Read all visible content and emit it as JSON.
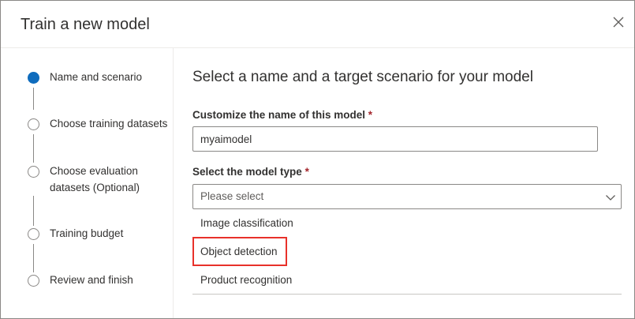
{
  "dialog": {
    "title": "Train a new model",
    "close_icon": "close-icon"
  },
  "stepper": {
    "steps": [
      {
        "label": "Name and scenario",
        "active": true
      },
      {
        "label": "Choose training datasets",
        "active": false
      },
      {
        "label": "Choose evaluation datasets (Optional)",
        "active": false
      },
      {
        "label": "Training budget",
        "active": false
      },
      {
        "label": "Review and finish",
        "active": false
      }
    ]
  },
  "form": {
    "heading": "Select a name and a target scenario for your model",
    "name_field": {
      "label": "Customize the name of this model",
      "required_marker": "*",
      "value": "myaimodel"
    },
    "model_type": {
      "label": "Select the model type",
      "required_marker": "*",
      "placeholder": "Please select",
      "chevron_icon": "chevron-down-icon",
      "options": [
        "Image classification",
        "Object detection",
        "Product recognition"
      ],
      "highlighted_option": "Object detection"
    }
  },
  "colors": {
    "accent": "#0f6cbd",
    "required": "#a4262c",
    "highlight": "#e8312a"
  }
}
